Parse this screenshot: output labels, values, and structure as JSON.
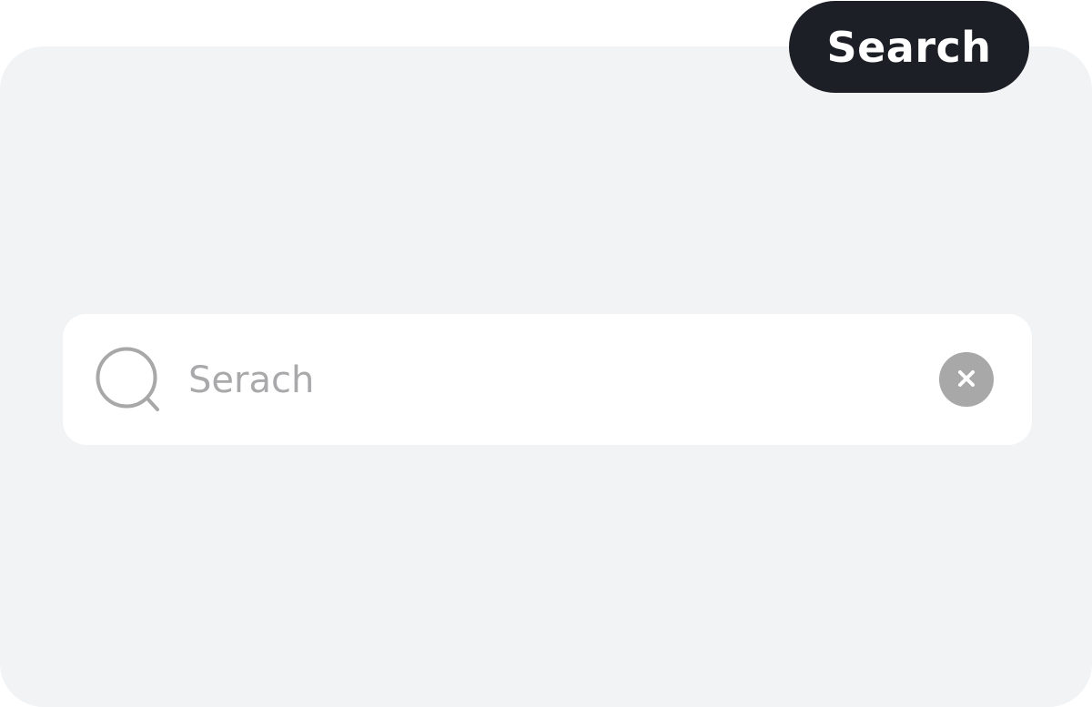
{
  "header": {
    "badge_label": "Search"
  },
  "search": {
    "value": "",
    "placeholder": "Serach",
    "icon": "search-icon",
    "clear_icon": "close-icon"
  },
  "colors": {
    "badge_background": "#1c1f26",
    "panel_background": "#f2f3f5",
    "input_background": "#ffffff",
    "icon_gray": "#a8a8a8"
  }
}
